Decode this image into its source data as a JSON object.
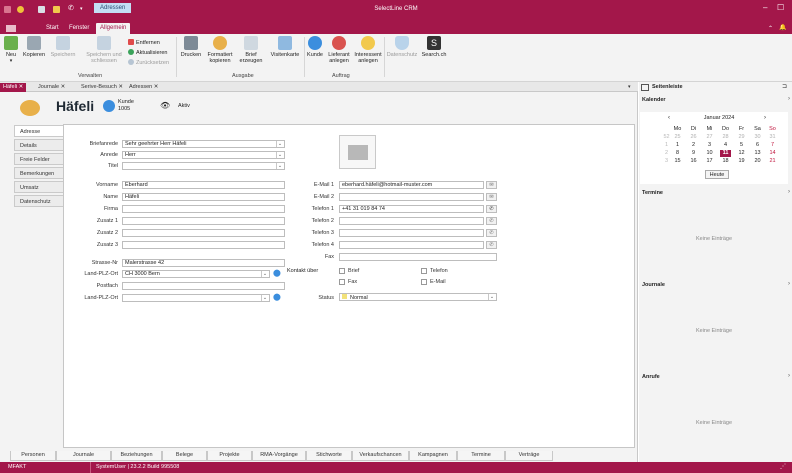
{
  "app": {
    "title": "SelectLine CRM",
    "doc_tab": "Adressen"
  },
  "tabs": {
    "start": "Start",
    "fenster": "Fenster",
    "allgemein": "Allgemein"
  },
  "ribbon": {
    "neu": "Neu",
    "kopieren": "Kopieren",
    "speichern": "Speichern",
    "speichern_und_schliessen": "Speichern und schliessen",
    "entfernen": "Entfernen",
    "aktualisieren": "Aktualisieren",
    "zuruecksetzen": "Zurücksetzen",
    "drucken": "Drucken",
    "formatiert_kopieren": "Formatiert kopieren",
    "brief_erzeugen": "Brief erzeugen",
    "visitenkarte": "Visitenkarte",
    "kunde": "Kunde",
    "lieferant_anlegen": "Lieferant anlegen",
    "interessent_anlegen": "Interessent anlegen",
    "datenschutz": "Datenschutz",
    "searchch": "Search.ch",
    "group_verwalten": "Verwalten",
    "group_ausgabe": "Ausgabe",
    "group_auftrag": "Auftrag"
  },
  "doc_tabs": [
    "Häfeli",
    "Journale",
    "Serive-Besuch",
    "Adressen"
  ],
  "header": {
    "name": "Häfeli",
    "kunde_label": "Kunde",
    "kunde_nr": "1005",
    "status": "Aktiv"
  },
  "side_tabs": [
    "Adresse",
    "Details",
    "Freie Felder",
    "Bemerkungen",
    "Umsatz",
    "Datenschutz"
  ],
  "form": {
    "briefanrede": {
      "label": "Briefanrede",
      "value": "Sehr geehrter Herr Häfeli"
    },
    "anrede": {
      "label": "Anrede",
      "value": "Herr"
    },
    "titel": {
      "label": "Titel",
      "value": ""
    },
    "vorname": {
      "label": "Vorname",
      "value": "Eberhard"
    },
    "name": {
      "label": "Name",
      "value": "Häfeli"
    },
    "firma": {
      "label": "Firma",
      "value": ""
    },
    "zusatz1": {
      "label": "Zusatz 1",
      "value": ""
    },
    "zusatz2": {
      "label": "Zusatz 2",
      "value": ""
    },
    "zusatz3": {
      "label": "Zusatz 3",
      "value": ""
    },
    "strasse": {
      "label": "Strasse-Nr",
      "value": "Malerstrasse 42"
    },
    "land_plz_ort": {
      "label": "Land-PLZ-Ort",
      "value": "CH 3000 Bern"
    },
    "postfach": {
      "label": "Postfach",
      "value": ""
    },
    "land_plz_ort2": {
      "label": "Land-PLZ-Ort",
      "value": ""
    },
    "email1": {
      "label": "E-Mail 1",
      "value": "eberhard.häfeli@hotmail-muster.com"
    },
    "email2": {
      "label": "E-Mail 2",
      "value": ""
    },
    "telefon1": {
      "label": "Telefon 1",
      "value": "+41 31 019 84 74"
    },
    "telefon2": {
      "label": "Telefon 2",
      "value": ""
    },
    "telefon3": {
      "label": "Telefon 3",
      "value": ""
    },
    "telefon4": {
      "label": "Telefon 4",
      "value": ""
    },
    "fax": {
      "label": "Fax",
      "value": ""
    },
    "kontakt_ueber": "Kontakt über",
    "kontakt_opts": {
      "brief": "Brief",
      "telefon": "Telefon",
      "fax": "Fax",
      "email": "E-Mail"
    },
    "status": {
      "label": "Status",
      "value": "Normal"
    }
  },
  "bottom_tabs": [
    "Personen",
    "Journale",
    "Beziehungen",
    "Belege",
    "Projekte",
    "RMA-Vorgänge",
    "Stichworte",
    "Verkaufschancen",
    "Kampagnen",
    "Termine",
    "Verträge"
  ],
  "statusbar": {
    "left": "MFAKT",
    "version": "SystemUser | 23.2.2 Build 995508"
  },
  "sidebar": {
    "title": "Seitenleiste",
    "kalender": "Kalender",
    "month": "Januar 2024",
    "weekdays": [
      "Mo",
      "Di",
      "Mi",
      "Do",
      "Fr",
      "Sa",
      "So"
    ],
    "weeks": [
      {
        "kw": "52",
        "days": [
          "25",
          "26",
          "27",
          "28",
          "29",
          "30",
          "31"
        ]
      },
      {
        "kw": "1",
        "days": [
          "1",
          "2",
          "3",
          "4",
          "5",
          "6",
          "7"
        ]
      },
      {
        "kw": "2",
        "days": [
          "8",
          "9",
          "10",
          "11",
          "12",
          "13",
          "14"
        ]
      },
      {
        "kw": "3",
        "days": [
          "15",
          "16",
          "17",
          "18",
          "19",
          "20",
          "21"
        ]
      }
    ],
    "heute": "Heute",
    "termine": "Termine",
    "journale": "Journale",
    "anrufe": "Anrufe",
    "empty": "Keine Einträge"
  },
  "colors": {
    "brand": "#a3174a",
    "accent_blue": "#c3dff4"
  }
}
